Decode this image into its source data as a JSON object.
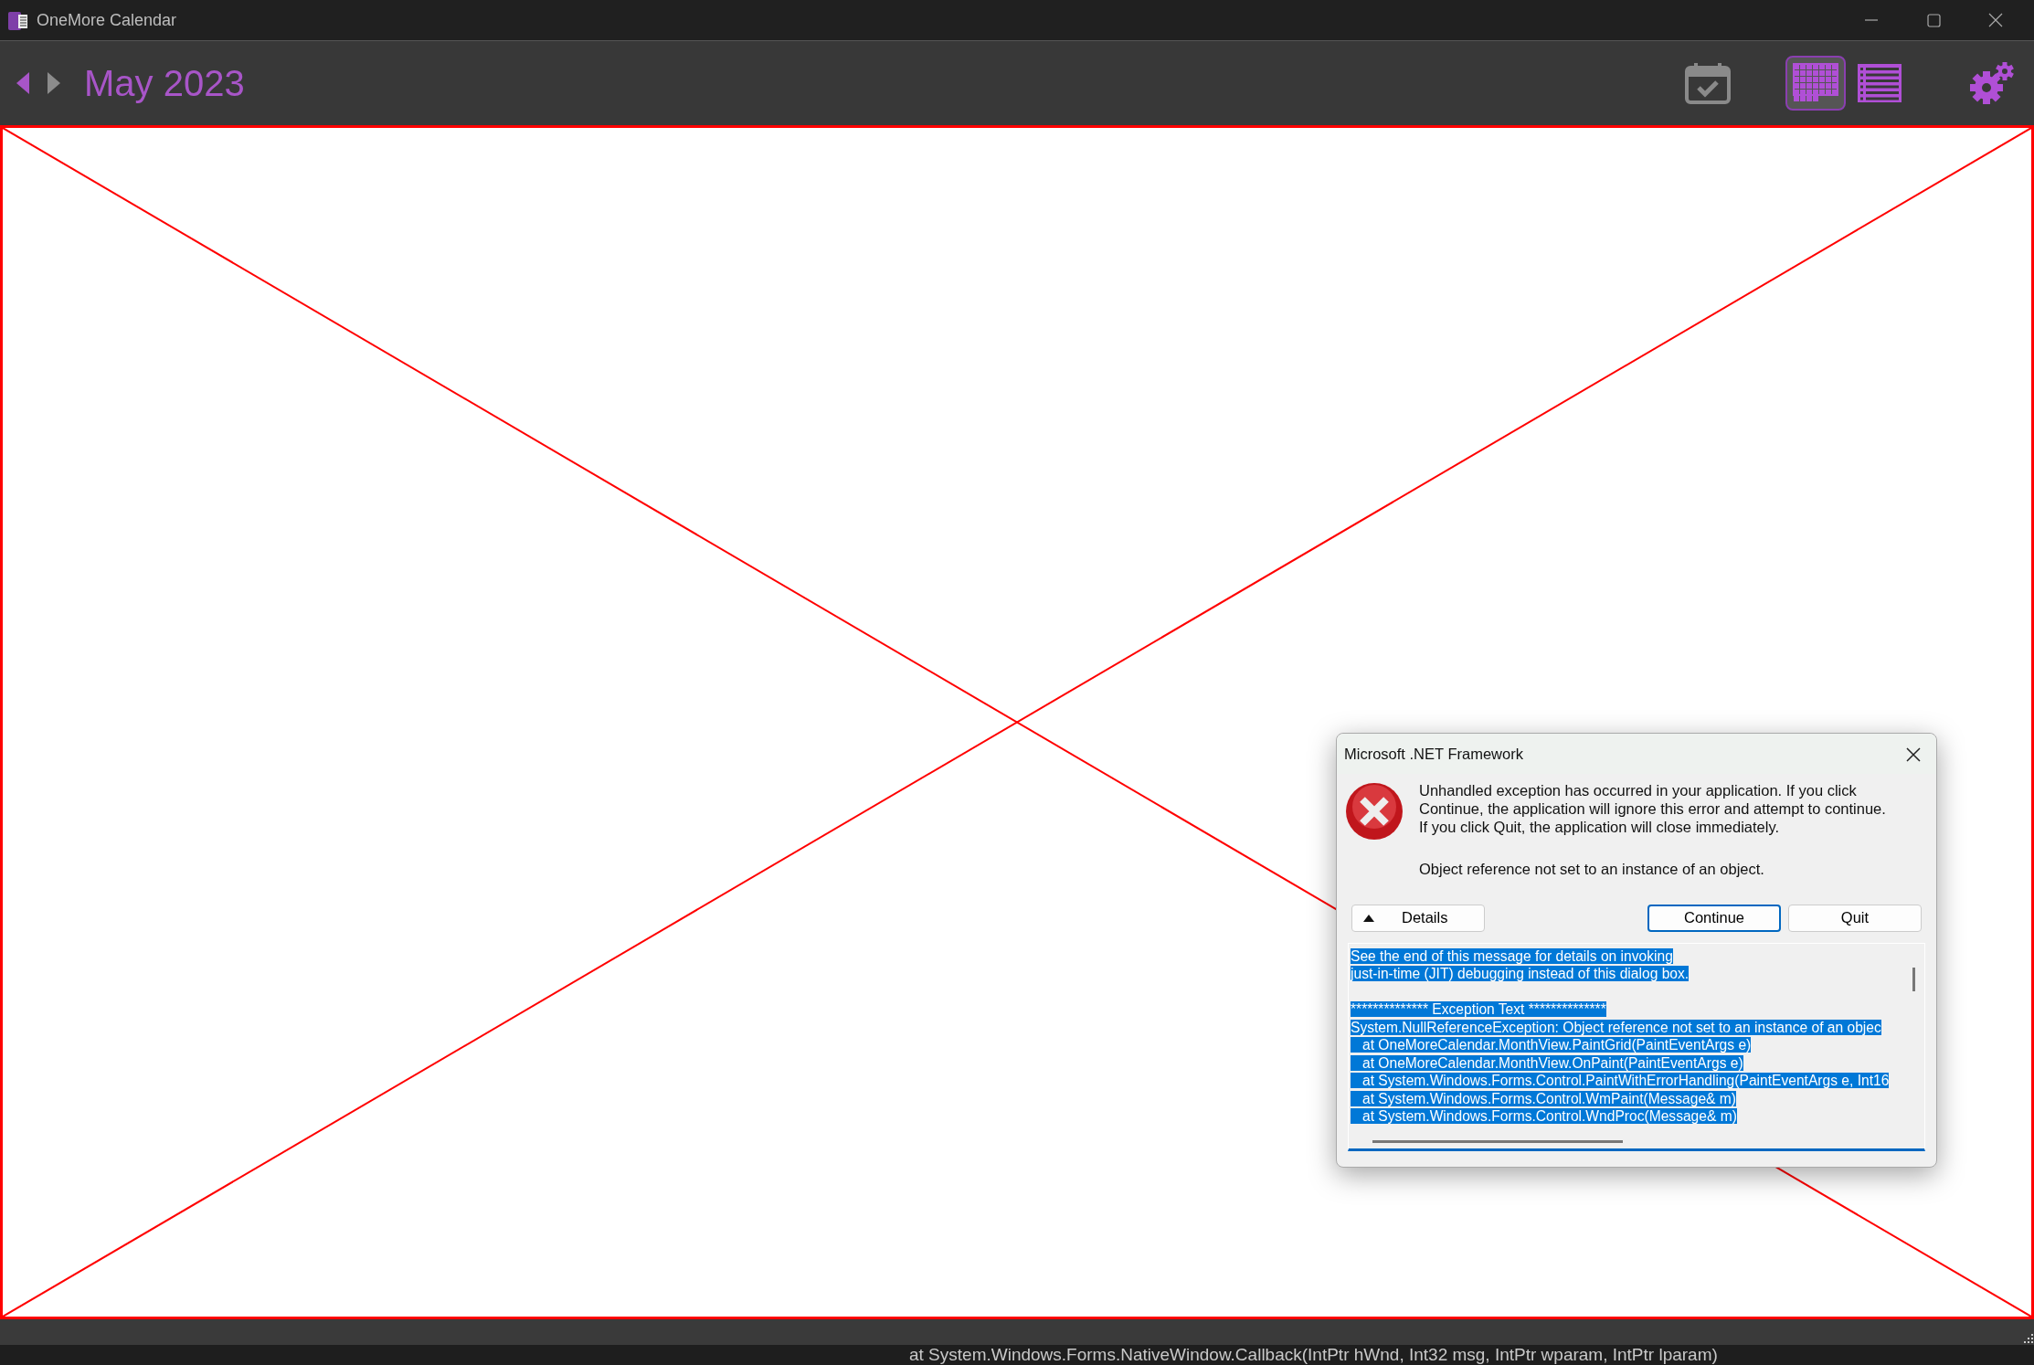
{
  "window": {
    "title": "OneMore Calendar"
  },
  "toolbar": {
    "month": "May 2023",
    "views": [
      {
        "kind": "month",
        "selected": true
      },
      {
        "kind": "list",
        "selected": false
      }
    ]
  },
  "dialog": {
    "title": "Microsoft .NET Framework",
    "message": "Unhandled exception has occurred in your application. If you click Continue, the application will ignore this error and attempt to continue. If you click Quit, the application will close immediately.",
    "error": "Object reference not set to an instance of an object.",
    "details_button": "Details",
    "buttons": [
      {
        "label": "Continue",
        "default": true
      },
      {
        "label": "Quit",
        "default": false
      }
    ],
    "details_intro": [
      "See the end of this message for details on invoking",
      "just-in-time (JIT) debugging instead of this dialog box."
    ],
    "details": [
      "************** Exception Text **************",
      "System.NullReferenceException: Object reference not set to an instance of an objec",
      "   at OneMoreCalendar.MonthView.PaintGrid(PaintEventArgs e)",
      "   at OneMoreCalendar.MonthView.OnPaint(PaintEventArgs e)",
      "   at System.Windows.Forms.Control.PaintWithErrorHandling(PaintEventArgs e, Int16",
      "   at System.Windows.Forms.Control.WmPaint(Message& m)",
      "   at System.Windows.Forms.Control.WndProc(Message& m)"
    ]
  },
  "background_text": "at System.Windows.Forms.NativeWindow.Callback(IntPtr hWnd, Int32 msg, IntPtr wparam, IntPtr lparam)"
}
